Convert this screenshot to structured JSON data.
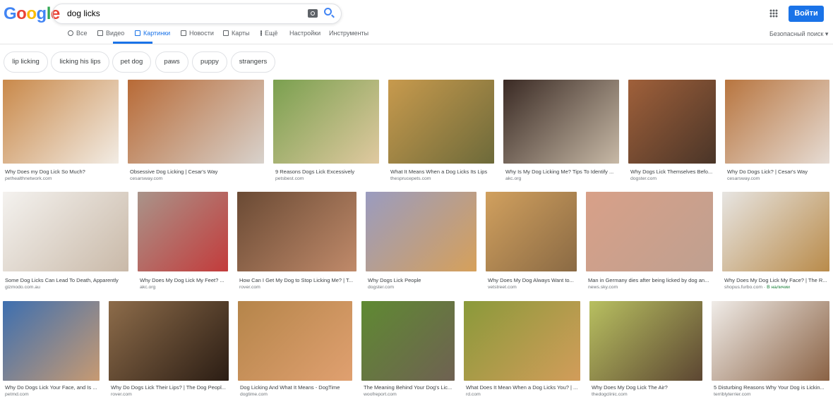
{
  "header": {
    "logo": "Google",
    "query": "dog licks",
    "sign_in": "Войти",
    "safe_search": "Безопасный поиск ▾"
  },
  "tabs": [
    {
      "label": "Все",
      "icon": "search-icon"
    },
    {
      "label": "Видео",
      "icon": "video-icon"
    },
    {
      "label": "Картинки",
      "icon": "image-icon",
      "active": true
    },
    {
      "label": "Новости",
      "icon": "news-icon"
    },
    {
      "label": "Карты",
      "icon": "map-pin-icon"
    },
    {
      "label": "Ещё",
      "icon": "more-vert-icon"
    },
    {
      "label": "Настройки"
    },
    {
      "label": "Инструменты"
    }
  ],
  "chips": [
    "lip licking",
    "licking his lips",
    "pet dog",
    "paws",
    "puppy",
    "strangers"
  ],
  "results": [
    {
      "title": "Why Does my Dog Lick So Much?",
      "source": "pethealthnetwork.com"
    },
    {
      "title": "Obsessive Dog Licking | Cesar's Way",
      "source": "cesarsway.com"
    },
    {
      "title": "9 Reasons Dogs Lick Excessively",
      "source": "petsbest.com"
    },
    {
      "title": "What It Means When a Dog Licks Its Lips",
      "source": "thesprucepets.com"
    },
    {
      "title": "Why Is My Dog Licking Me? Tips To Identify ...",
      "source": "akc.org"
    },
    {
      "title": "Why Dogs Lick Themselves Befo...",
      "source": "dogster.com"
    },
    {
      "title": "Why Do Dogs Lick? | Cesar's Way",
      "source": "cesarsway.com"
    },
    {
      "title": "Some Dog Licks Can Lead To Death, Apparently",
      "source": "gizmodo.com.au"
    },
    {
      "title": "Why Does My Dog Lick My Feet? ...",
      "source": "akc.org"
    },
    {
      "title": "How Can I Get My Dog to Stop Licking Me? | T...",
      "source": "rover.com"
    },
    {
      "title": "Why Dogs Lick People",
      "source": "dogster.com"
    },
    {
      "title": "Why Does My Dog Always Want to...",
      "source": "vetstreet.com"
    },
    {
      "title": "Man in Germany dies after being licked by dog an...",
      "source": "news.sky.com"
    },
    {
      "title": "Why Does My Dog Lick My Face? | The R...",
      "source": "shopus.furbo.com",
      "badge": "· В наличии"
    },
    {
      "title": "Why Do Dogs Lick Your Face, and Is ...",
      "source": "petmd.com"
    },
    {
      "title": "Why Do Dogs Lick Their Lips? | The Dog Peopl...",
      "source": "rover.com"
    },
    {
      "title": "Dog Licking And What It Means - DogTime",
      "source": "dogtime.com"
    },
    {
      "title": "The Meaning Behind Your Dog's Lic...",
      "source": "woofreport.com"
    },
    {
      "title": "What Does It Mean When a Dog Licks You? | ...",
      "source": "rd.com"
    },
    {
      "title": "Why Does My Dog Lick The Air?",
      "source": "thedogclinic.com"
    },
    {
      "title": "5 Disturbing Reasons Why Your Dog is Lickin...",
      "source": "terriblyterrier.com"
    }
  ]
}
